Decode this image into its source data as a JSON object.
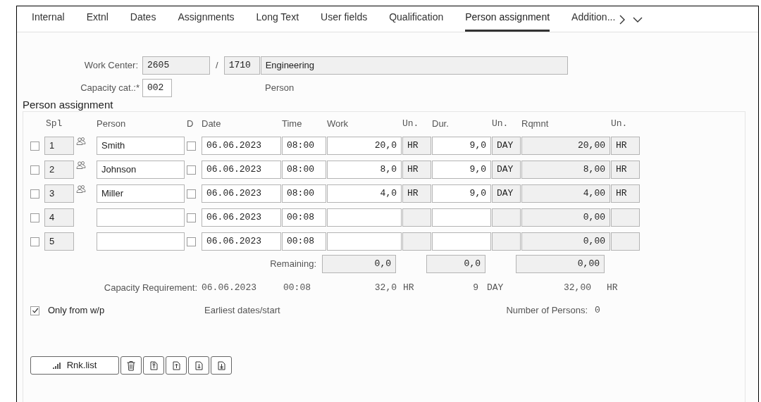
{
  "tabs": [
    {
      "label": "Internal",
      "selected": false
    },
    {
      "label": "Extnl",
      "selected": false
    },
    {
      "label": "Dates",
      "selected": false
    },
    {
      "label": "Assignments",
      "selected": false
    },
    {
      "label": "Long Text",
      "selected": false
    },
    {
      "label": "User fields",
      "selected": false
    },
    {
      "label": "Qualification",
      "selected": false
    },
    {
      "label": "Person assignment",
      "selected": true
    },
    {
      "label": "Addition...",
      "selected": false
    }
  ],
  "header": {
    "work_center_label": "Work Center:",
    "work_center": "2605",
    "separator": "/",
    "plant": "1710",
    "work_center_name": "Engineering",
    "capacity_label": "Capacity cat.:*",
    "capacity": "002",
    "capacity_text": "Person"
  },
  "section_title": "Person assignment",
  "columns": [
    "Spl",
    "Person",
    "D",
    "Date",
    "Time",
    "Work",
    "Un.",
    "Dur.",
    "Un.",
    "Rqmnt",
    "Un."
  ],
  "rows": [
    {
      "selected": false,
      "kind": "person",
      "spl": "1",
      "person": "Smith",
      "d_checked": false,
      "date": "06.06.2023",
      "time": "08:00",
      "work": "20,0",
      "work_unit": "HR",
      "duration": "9,0",
      "duration_unit": "DAY",
      "requirement": "20,00",
      "requirement_unit": "HR"
    },
    {
      "selected": false,
      "kind": "person",
      "spl": "2",
      "person": "Johnson",
      "d_checked": false,
      "date": "06.06.2023",
      "time": "08:00",
      "work": "8,0",
      "work_unit": "HR",
      "duration": "9,0",
      "duration_unit": "DAY",
      "requirement": "8,00",
      "requirement_unit": "HR"
    },
    {
      "selected": false,
      "kind": "person",
      "spl": "3",
      "person": "Miller",
      "d_checked": false,
      "date": "06.06.2023",
      "time": "08:00",
      "work": "4,0",
      "work_unit": "HR",
      "duration": "9,0",
      "duration_unit": "DAY",
      "requirement": "4,00",
      "requirement_unit": "HR"
    },
    {
      "selected": false,
      "kind": "blank",
      "spl": "4",
      "d_checked": false,
      "date": "06.06.2023",
      "time": "00:08",
      "requirement": "0,00"
    },
    {
      "selected": false,
      "kind": "blank",
      "spl": "5",
      "d_checked": false,
      "date": "06.06.2023",
      "time": "00:08",
      "requirement": "0,00"
    }
  ],
  "remaining": {
    "label": "Remaining:",
    "work": "0,0",
    "duration": "0,0",
    "requirement": "0,00"
  },
  "capacity_requirement": {
    "label": "Capacity Requirement:",
    "date": "06.06.2023",
    "time": "00:08",
    "work": "32,0",
    "work_unit": "HR",
    "duration": "9",
    "duration_unit": "DAY",
    "requirement": "32,00",
    "requirement_unit": "HR"
  },
  "only_from_wp": {
    "label": "Only from w/p",
    "checked": true
  },
  "earliest_dates": "Earliest dates/start",
  "number_of_persons": {
    "label": "Number of Persons:",
    "value": "0"
  },
  "rank_button": "Rnk.list"
}
